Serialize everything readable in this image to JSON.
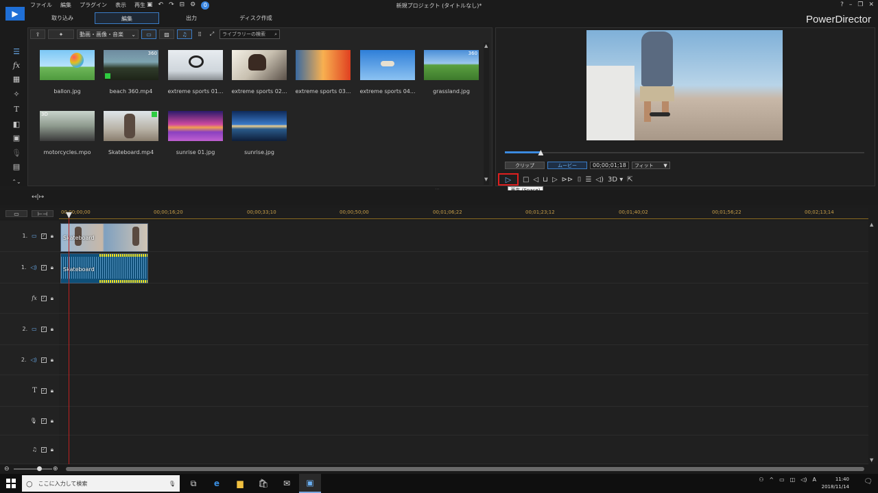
{
  "app": {
    "brand": "PowerDirector",
    "project_title": "新規プロジェクト (タイトルなし)*"
  },
  "menu": [
    "ファイル",
    "編集",
    "プラグイン",
    "表示",
    "再生"
  ],
  "notification_count": "0",
  "tabs": [
    {
      "label": "取り込み",
      "active": false
    },
    {
      "label": "編集",
      "active": true
    },
    {
      "label": "出力",
      "active": false
    },
    {
      "label": "ディスク作成",
      "active": false
    }
  ],
  "library": {
    "filter_label": "動画・画像・音楽",
    "search_placeholder": "ライブラリーの検索",
    "items": [
      {
        "caption": "ballon.jpg",
        "tag": ""
      },
      {
        "caption": "beach 360.mp4",
        "tag": "360"
      },
      {
        "caption": "extreme sports 01...",
        "tag": ""
      },
      {
        "caption": "extreme sports 02...",
        "tag": ""
      },
      {
        "caption": "extreme sports 03...",
        "tag": ""
      },
      {
        "caption": "extreme sports 04...",
        "tag": ""
      },
      {
        "caption": "grassland.jpg",
        "tag": "360"
      },
      {
        "caption": "motorcycles.mpo",
        "tag": "3D"
      },
      {
        "caption": "Skateboard.mp4",
        "tag": ""
      },
      {
        "caption": "sunrise 01.jpg",
        "tag": ""
      },
      {
        "caption": "sunrise.jpg",
        "tag": ""
      }
    ]
  },
  "preview": {
    "clip_label": "クリップ",
    "movie_label": "ムービー",
    "timecode": "00;00;01;18",
    "fit_label": "フィット",
    "three_d_label": "3D",
    "seek_position": 0.1,
    "tooltip": "再生 (Space)"
  },
  "timeline": {
    "ticks": [
      "00;00;00;00",
      "00;00;16;20",
      "00;00;33;10",
      "00;00;50;00",
      "00;01;06;22",
      "00;01;23;12",
      "00;01;40;02",
      "00;01;56;22",
      "00;02;13;14"
    ],
    "tracks": [
      {
        "label": "1.",
        "icon": "video-track-icon"
      },
      {
        "label": "1.",
        "icon": "audio-track-icon"
      },
      {
        "label": "fx",
        "icon": "fx-track-icon"
      },
      {
        "label": "2.",
        "icon": "video-track-icon"
      },
      {
        "label": "2.",
        "icon": "audio-track-icon"
      },
      {
        "label": "T",
        "icon": "title-track-icon"
      },
      {
        "label": "",
        "icon": "voice-track-icon"
      },
      {
        "label": "",
        "icon": "music-track-icon"
      }
    ],
    "video_clip_name": "Skateboard",
    "audio_clip_name": "Skateboard"
  },
  "taskbar": {
    "search_placeholder": "ここに入力して検索",
    "time": "11:40",
    "date": "2018/11/14"
  },
  "colors": {
    "accent": "#3b7ec9",
    "highlight_box": "#e01f1f",
    "ruler_text": "#c9a04a"
  }
}
